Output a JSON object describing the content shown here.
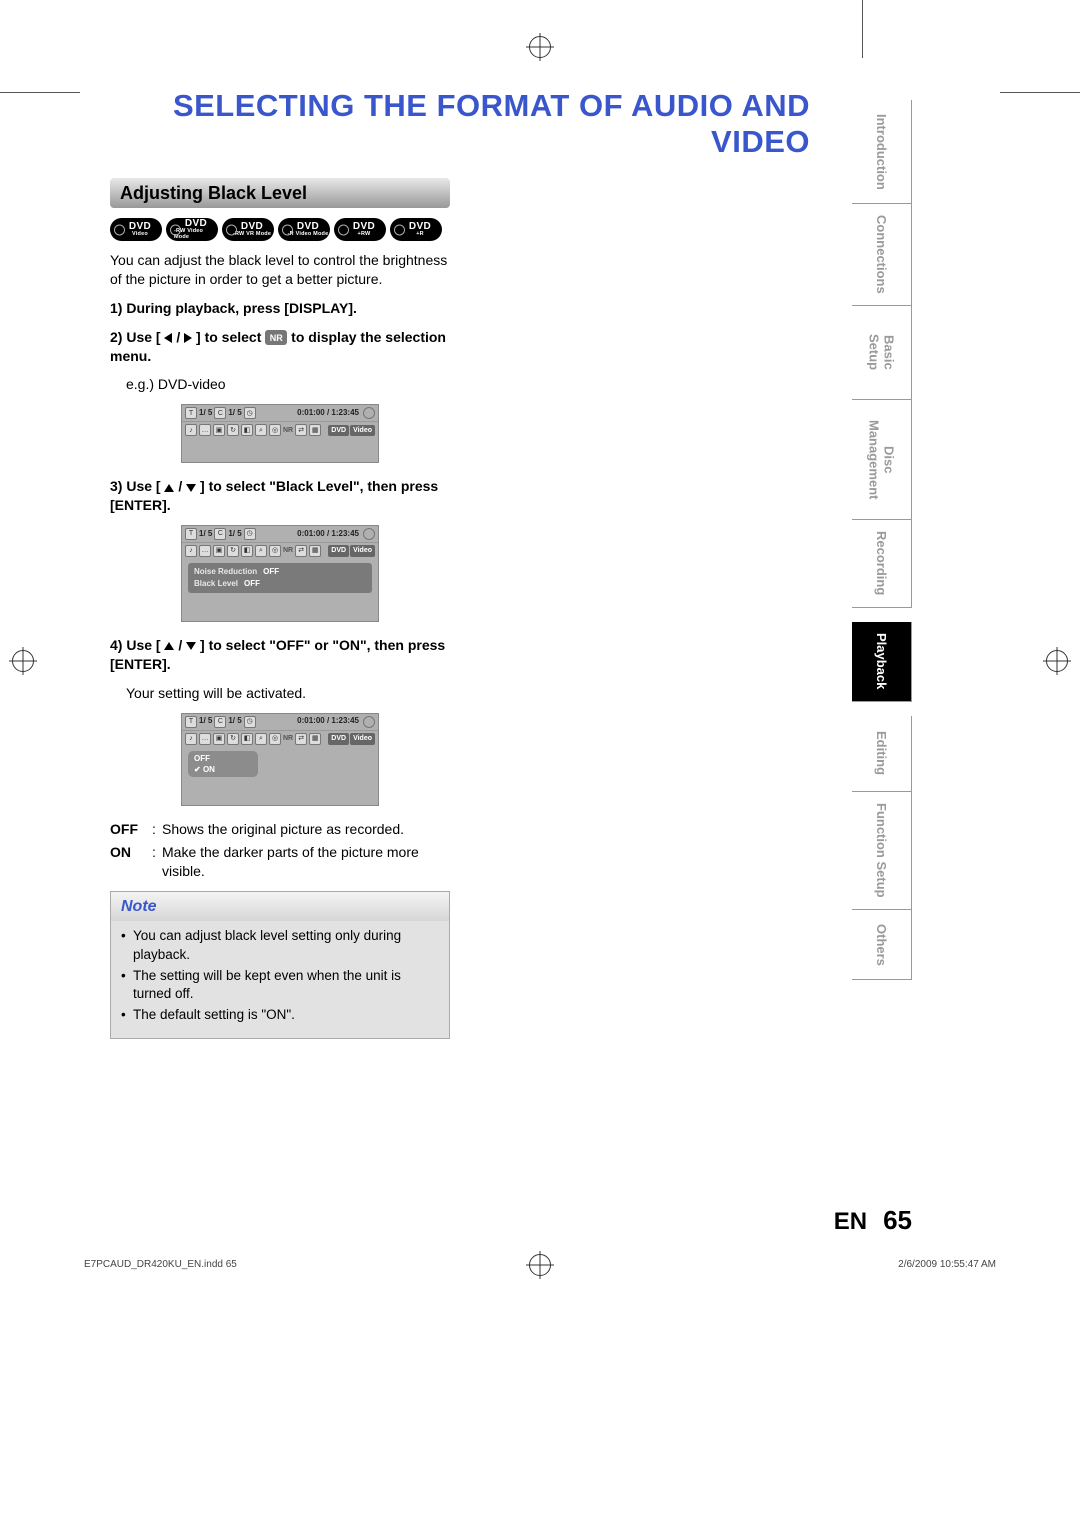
{
  "page_title": "SELECTING THE FORMAT OF AUDIO AND VIDEO",
  "section_title": "Adjusting Black Level",
  "badges": [
    {
      "top": "DVD",
      "bot": "Video"
    },
    {
      "top": "DVD",
      "bot": "-RW Video Mode"
    },
    {
      "top": "DVD",
      "bot": "-RW VR Mode"
    },
    {
      "top": "DVD",
      "bot": "-R Video Mode"
    },
    {
      "top": "DVD",
      "bot": "+RW"
    },
    {
      "top": "DVD",
      "bot": "+R"
    }
  ],
  "intro": "You can adjust the black level to control the brightness of the picture in order to get a better picture.",
  "steps": {
    "s1": "1) During playback, press [DISPLAY].",
    "s2a": "2) Use [",
    "s2b": "] to select ",
    "s2c": " to display the selection menu.",
    "s2_nr": "NR",
    "s2_eg": "e.g.) DVD-video",
    "s3": "3) Use [ ▲ / ▼ ] to select \"Black Level\", then press [ENTER].",
    "s4": "4) Use [ ▲ / ▼ ] to select \"OFF\" or \"ON\", then press [ENTER].",
    "s4_after": "Your setting will be activated."
  },
  "osd": {
    "title_count": "1/  5",
    "chap_count": "1/  5",
    "time": "0:01:00 / 1:23:45",
    "dvd": "DVD",
    "video": "Video",
    "nr": "NR",
    "menu": {
      "noise_reduction": "Noise Reduction",
      "black_level": "Black Level",
      "off": "OFF"
    },
    "select": {
      "off": "OFF",
      "on": "ON"
    }
  },
  "definitions": {
    "off_k": "OFF",
    "off_v": "Shows the original picture as recorded.",
    "on_k": "ON",
    "on_v": "Make the darker parts of the picture more visible."
  },
  "note": {
    "header": "Note",
    "items": [
      "You can adjust black level setting only during playback.",
      "The setting will be kept even when the unit is turned off.",
      "The default setting is \"ON\"."
    ]
  },
  "side_tabs": [
    "Introduction",
    "Connections",
    "Basic Setup",
    "Disc Management",
    "Recording",
    "Playback",
    "Editing",
    "Function Setup",
    "Others"
  ],
  "active_tab_index": 5,
  "page_number": {
    "lang": "EN",
    "num": "65"
  },
  "footer": {
    "left": "E7PCAUD_DR420KU_EN.indd   65",
    "right": "2/6/2009   10:55:47 AM"
  }
}
